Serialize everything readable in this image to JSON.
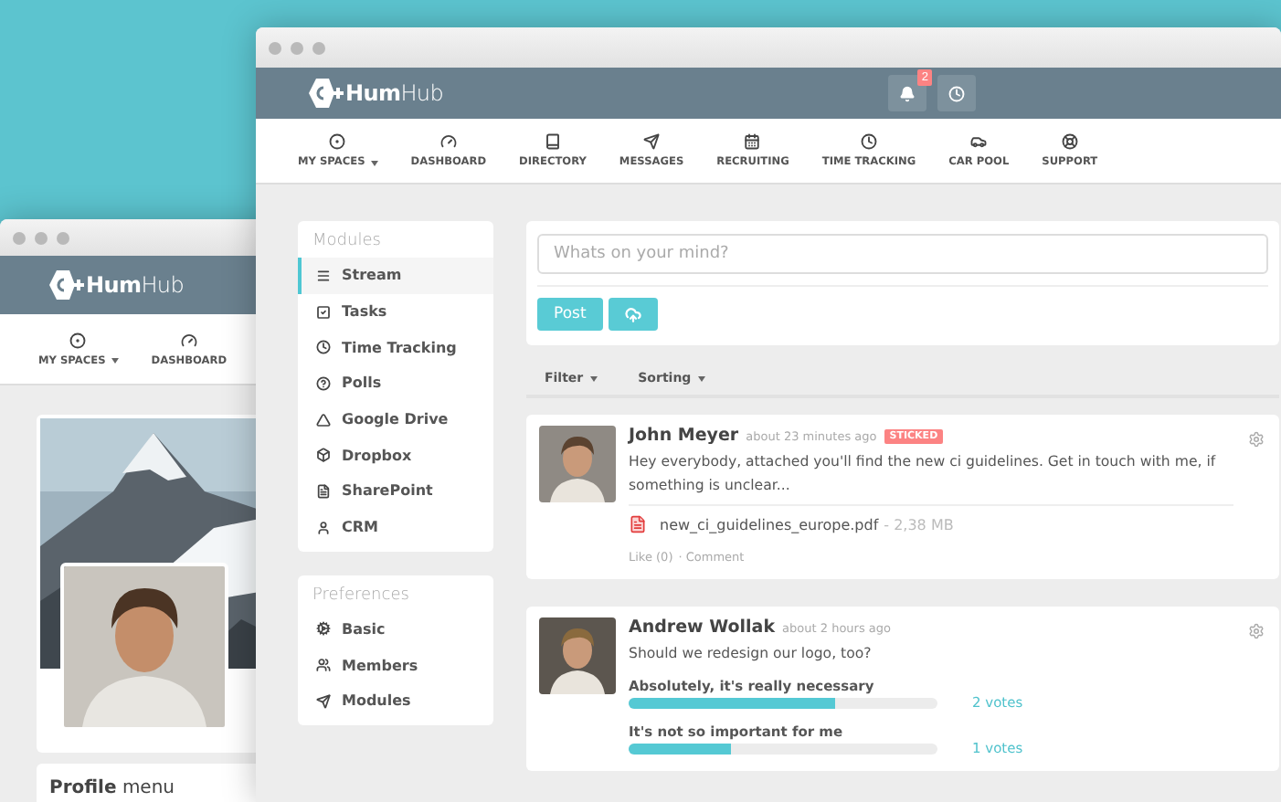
{
  "back_window": {
    "logo": "**Hum**Hub",
    "nav": [
      {
        "label": "MY SPACES",
        "has_menu": true
      },
      {
        "label": "DASHBOARD",
        "has_menu": false
      }
    ],
    "profile_menu": "**Profile** menu"
  },
  "front_window": {
    "logo": "**Hum**Hub",
    "notification_count": "2",
    "nav": [
      {
        "label": "MY SPACES",
        "has_menu": true
      },
      {
        "label": "DASHBOARD",
        "has_menu": false
      },
      {
        "label": "DIRECTORY",
        "has_menu": false
      },
      {
        "label": "MESSAGES",
        "has_menu": false
      },
      {
        "label": "RECRUITING",
        "has_menu": false
      },
      {
        "label": "TIME TRACKING",
        "has_menu": false
      },
      {
        "label": "CAR POOL",
        "has_menu": false
      },
      {
        "label": "SUPPORT",
        "has_menu": false
      }
    ],
    "sidebar": {
      "modules": {
        "title": "Modules",
        "items": [
          {
            "label": "Stream",
            "selected": true
          },
          {
            "label": "Tasks",
            "selected": false
          },
          {
            "label": "Time Tracking",
            "selected": false
          },
          {
            "label": "Polls",
            "selected": false
          },
          {
            "label": "Google Drive",
            "selected": false
          },
          {
            "label": "Dropbox",
            "selected": false
          },
          {
            "label": "SharePoint",
            "selected": false
          },
          {
            "label": "CRM",
            "selected": false
          }
        ]
      },
      "preferences": {
        "title": "Preferences",
        "items": [
          {
            "label": "Basic",
            "selected": false
          },
          {
            "label": "Members",
            "selected": false
          },
          {
            "label": "Modules",
            "selected": false
          }
        ]
      }
    },
    "composer": {
      "placeholder": "Whats on your mind?",
      "post_button": "Post"
    },
    "filters": [
      {
        "label": "Filter"
      },
      {
        "label": "Sorting"
      }
    ],
    "posts": [
      {
        "kind": "text",
        "author": "John Meyer",
        "time": "about 23 minutes ago",
        "badge": "STICKED",
        "text": "Hey everybody, attached you'll find the new ci guidelines. Get in touch with me, if something is unclear...",
        "attachment": {
          "name": "new_ci_guidelines_europe.pdf",
          "size": "- 2,38 MB"
        },
        "actions": [
          "Like (0)",
          "· Comment"
        ]
      },
      {
        "kind": "poll",
        "author": "Andrew Wollak",
        "time": "about 2 hours ago",
        "text": "Should we redesign our logo, too?",
        "answers": [
          {
            "label": "Absolutely, it's really necessary",
            "level": 0.67,
            "votes": "2 votes"
          },
          {
            "label": "It's not so important for me",
            "level": 0.33,
            "votes": "1 votes"
          }
        ]
      }
    ]
  }
}
